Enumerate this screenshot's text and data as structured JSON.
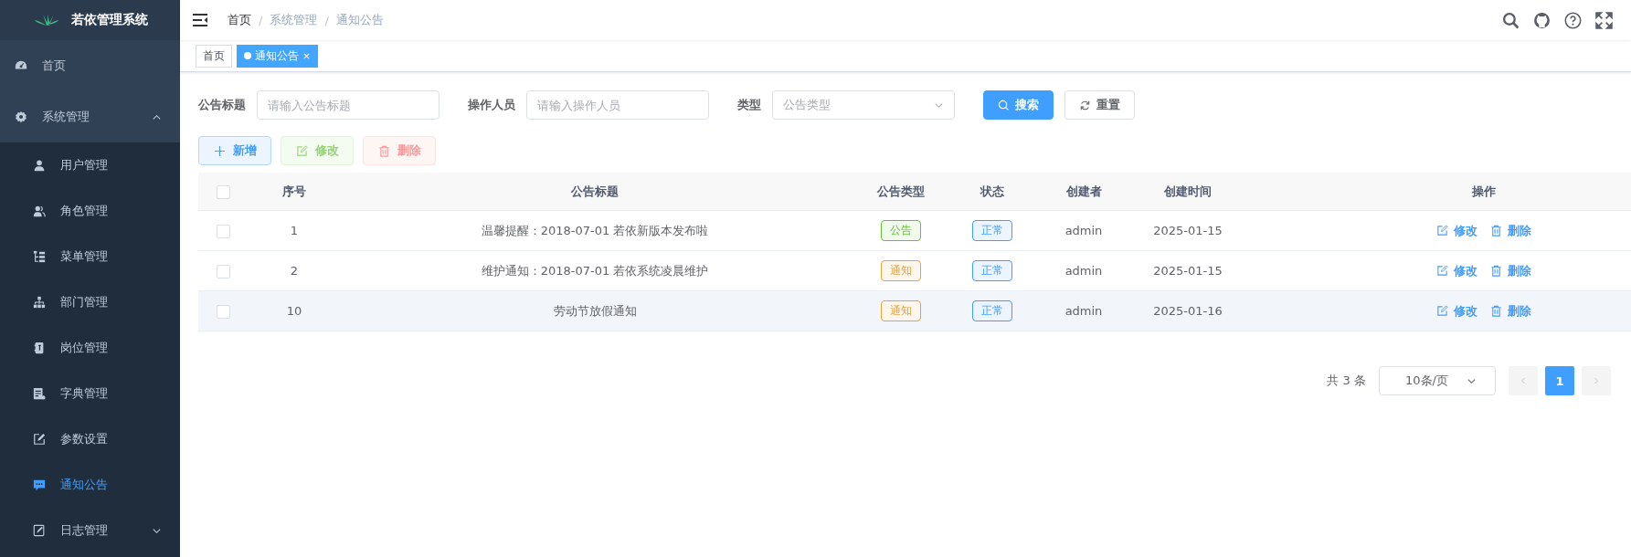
{
  "sidebar": {
    "logo_title": "若依管理系统",
    "items": [
      {
        "label": "首页",
        "selected": false
      },
      {
        "label": "系统管理",
        "selected": false,
        "expanded": true,
        "children": [
          {
            "label": "用户管理",
            "selected": false
          },
          {
            "label": "角色管理",
            "selected": false
          },
          {
            "label": "菜单管理",
            "selected": false
          },
          {
            "label": "部门管理",
            "selected": false
          },
          {
            "label": "岗位管理",
            "selected": false
          },
          {
            "label": "字典管理",
            "selected": false
          },
          {
            "label": "参数设置",
            "selected": false
          },
          {
            "label": "通知公告",
            "selected": true
          },
          {
            "label": "日志管理",
            "selected": false,
            "expanded": false
          }
        ]
      }
    ]
  },
  "breadcrumb": {
    "separator": "/",
    "items": [
      "首页",
      "系统管理",
      "通知公告"
    ]
  },
  "tags": [
    {
      "label": "首页",
      "selected": false,
      "closable": false
    },
    {
      "label": "通知公告",
      "selected": true,
      "closable": true
    }
  ],
  "filters": [
    {
      "label": "公告标题",
      "kind": "text",
      "placeholder": "请输入公告标题"
    },
    {
      "label": "操作人员",
      "kind": "text",
      "placeholder": "请输入操作人员"
    },
    {
      "label": "类型",
      "kind": "select",
      "placeholder": "公告类型"
    }
  ],
  "search_buttons": [
    {
      "label": "搜索",
      "kind": "primary"
    },
    {
      "label": "重置",
      "kind": "default"
    }
  ],
  "toolbar": [
    {
      "label": "新增",
      "kind": "add",
      "disabled": false
    },
    {
      "label": "修改",
      "kind": "edit",
      "disabled": true
    },
    {
      "label": "删除",
      "kind": "delete",
      "disabled": true
    }
  ],
  "table": {
    "all_checked": false,
    "columns": [
      "序号",
      "公告标题",
      "公告类型",
      "状态",
      "创建者",
      "创建时间",
      "操作"
    ],
    "rows": [
      {
        "checked": false,
        "highlighted": false,
        "index": "1",
        "title": "温馨提醒：2018-07-01 若依新版本发布啦",
        "type": {
          "label": "公告",
          "color": "#67c23a"
        },
        "status": {
          "label": "正常",
          "color": "#409eff"
        },
        "creator": "admin",
        "created": "2025-01-15",
        "actions": [
          {
            "label": "修改",
            "kind": "edit"
          },
          {
            "label": "删除",
            "kind": "delete"
          }
        ]
      },
      {
        "checked": false,
        "highlighted": false,
        "index": "2",
        "title": "维护通知：2018-07-01 若依系统凌晨维护",
        "type": {
          "label": "通知",
          "color": "#e6a23c"
        },
        "status": {
          "label": "正常",
          "color": "#409eff"
        },
        "creator": "admin",
        "created": "2025-01-15",
        "actions": [
          {
            "label": "修改",
            "kind": "edit"
          },
          {
            "label": "删除",
            "kind": "delete"
          }
        ]
      },
      {
        "checked": false,
        "highlighted": true,
        "index": "10",
        "title": "劳动节放假通知",
        "type": {
          "label": "通知",
          "color": "#e6a23c"
        },
        "status": {
          "label": "正常",
          "color": "#409eff"
        },
        "creator": "admin",
        "created": "2025-01-16",
        "actions": [
          {
            "label": "修改",
            "kind": "edit"
          },
          {
            "label": "删除",
            "kind": "delete"
          }
        ]
      }
    ]
  },
  "pagination": {
    "total": "共 3 条",
    "page_size": "10条/页",
    "pages": [
      {
        "label": "1",
        "selected": true
      }
    ]
  }
}
